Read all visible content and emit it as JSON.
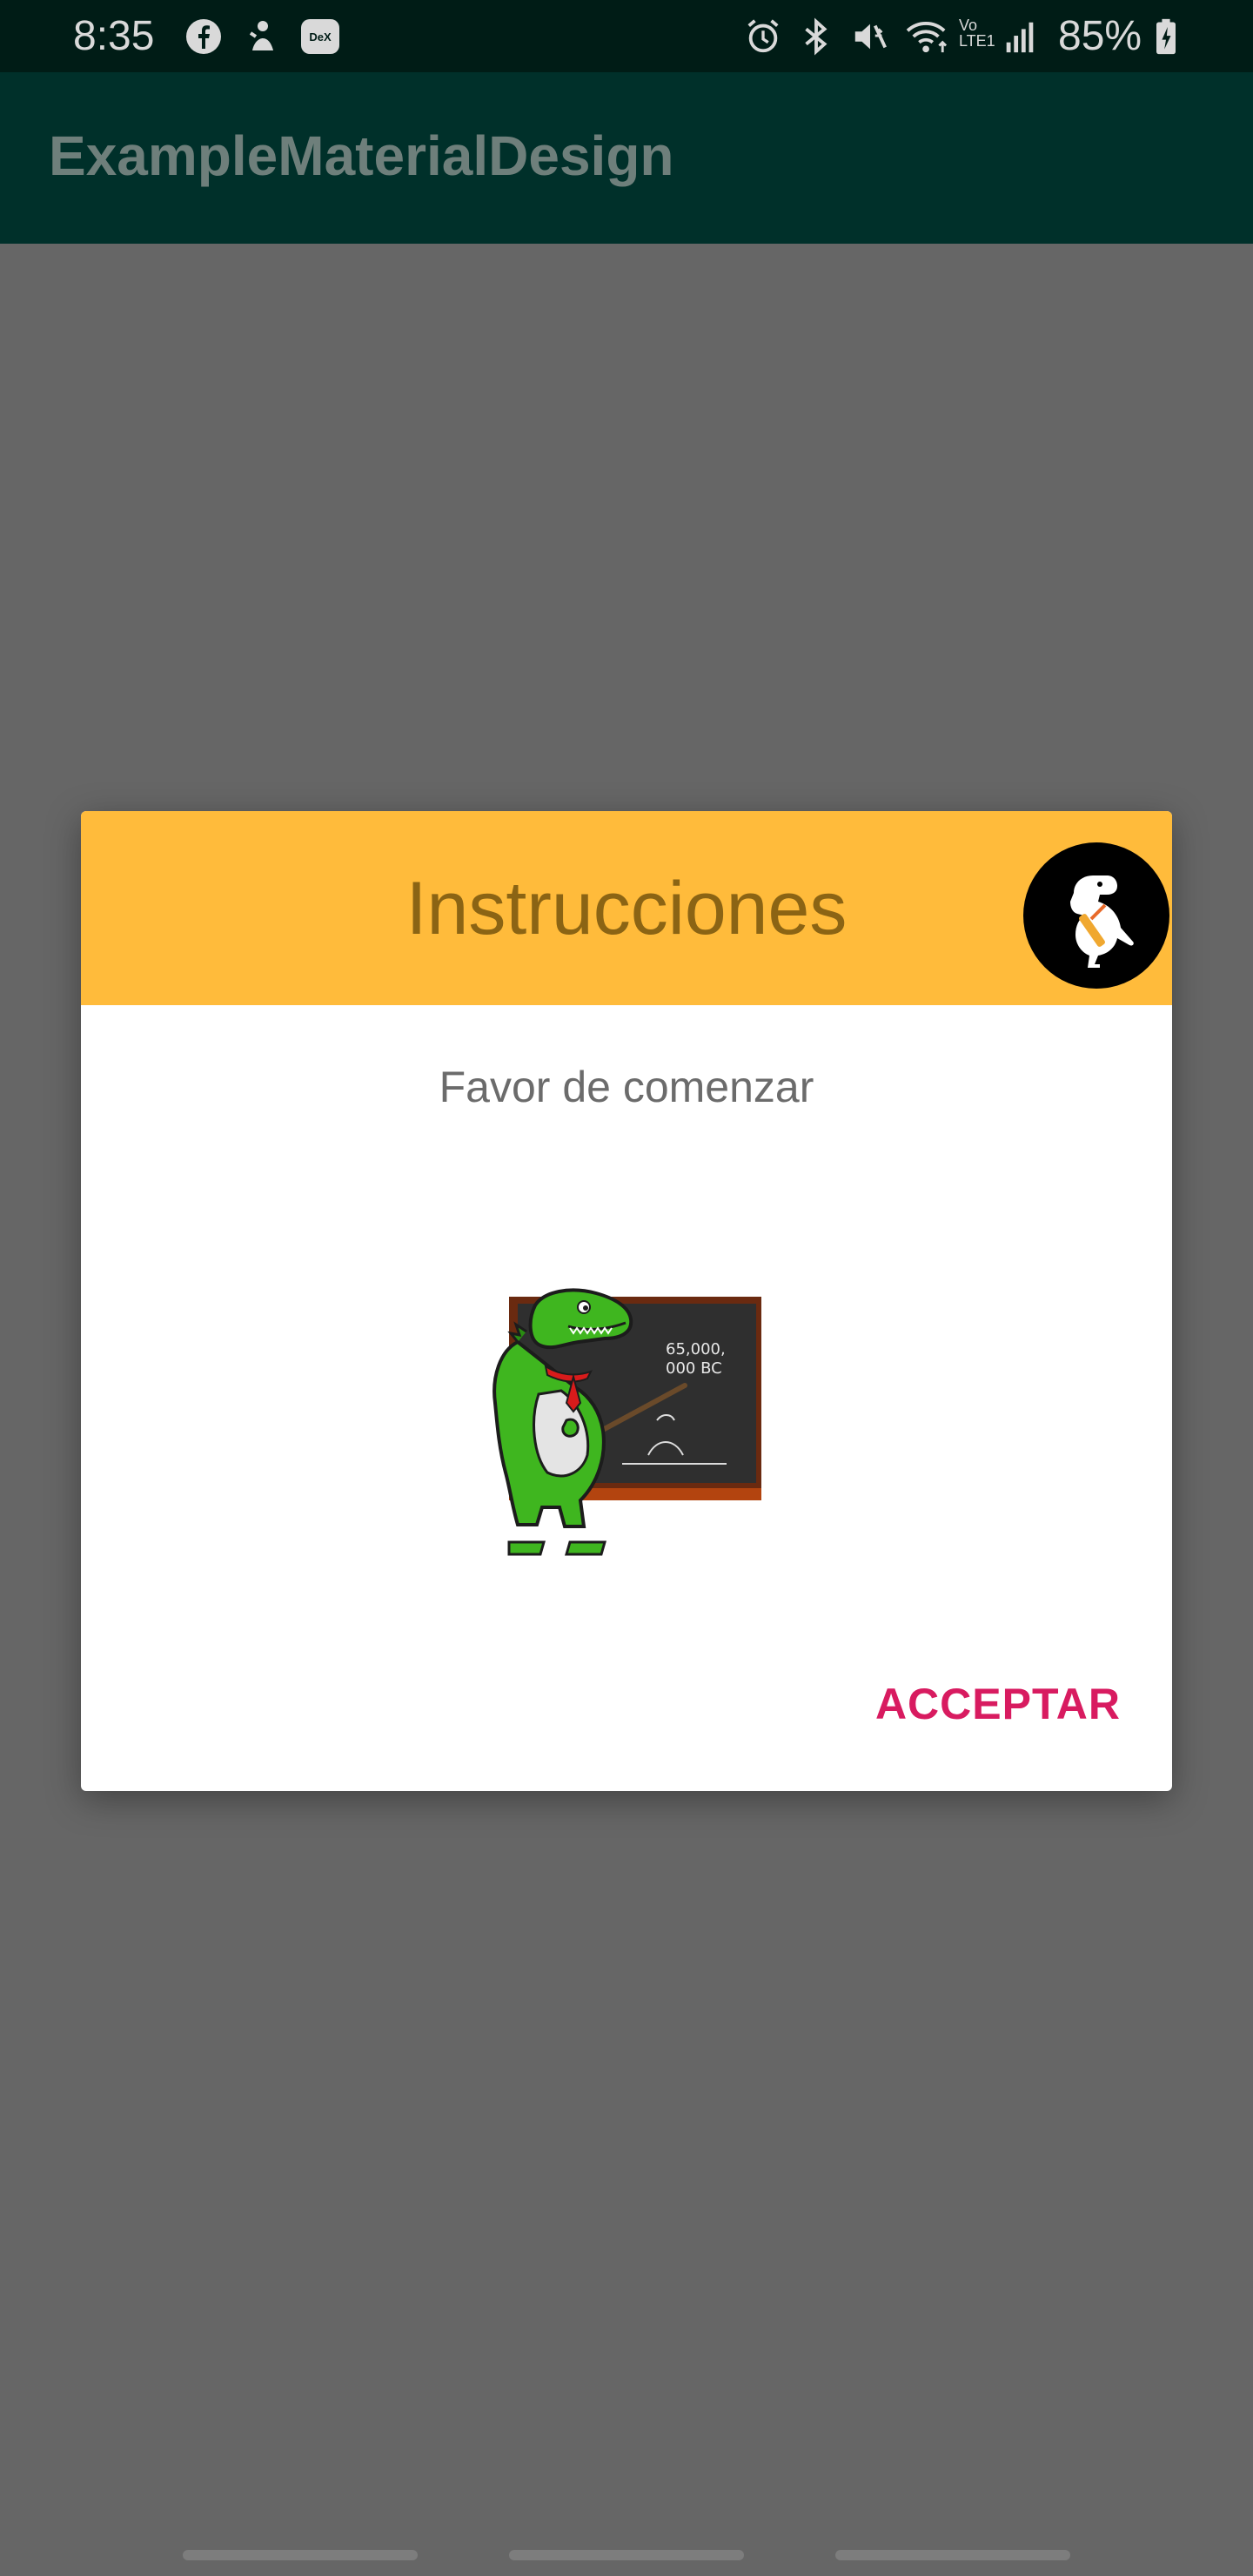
{
  "status_bar": {
    "time": "8:35",
    "battery": "85%",
    "left_icons": [
      "facebook-icon",
      "notification-icon",
      "dex-icon"
    ],
    "right_icons": [
      "alarm-icon",
      "bluetooth-icon",
      "mute-icon",
      "wifi-icon",
      "volte-icon",
      "signal-icon",
      "battery-icon"
    ],
    "dex_label": "DeX",
    "volte_label": "Vo LTE1"
  },
  "app_bar": {
    "title": "ExampleMaterialDesign"
  },
  "dialog": {
    "title": "Instrucciones",
    "message": "Favor de comenzar",
    "accept_label": "ACCEPTAR",
    "avatar_icon": "dinosaur-avatar-icon",
    "illustration": "dinosaur-teacher-illustration",
    "chalkboard_text_1": "65,000,",
    "chalkboard_text_2": "000 BC",
    "header_color": "#FFBB3B",
    "accent_color": "#D81B60"
  },
  "colors": {
    "status_bar": "#001C16",
    "app_bar": "#00302A",
    "scrim": "#666666"
  }
}
